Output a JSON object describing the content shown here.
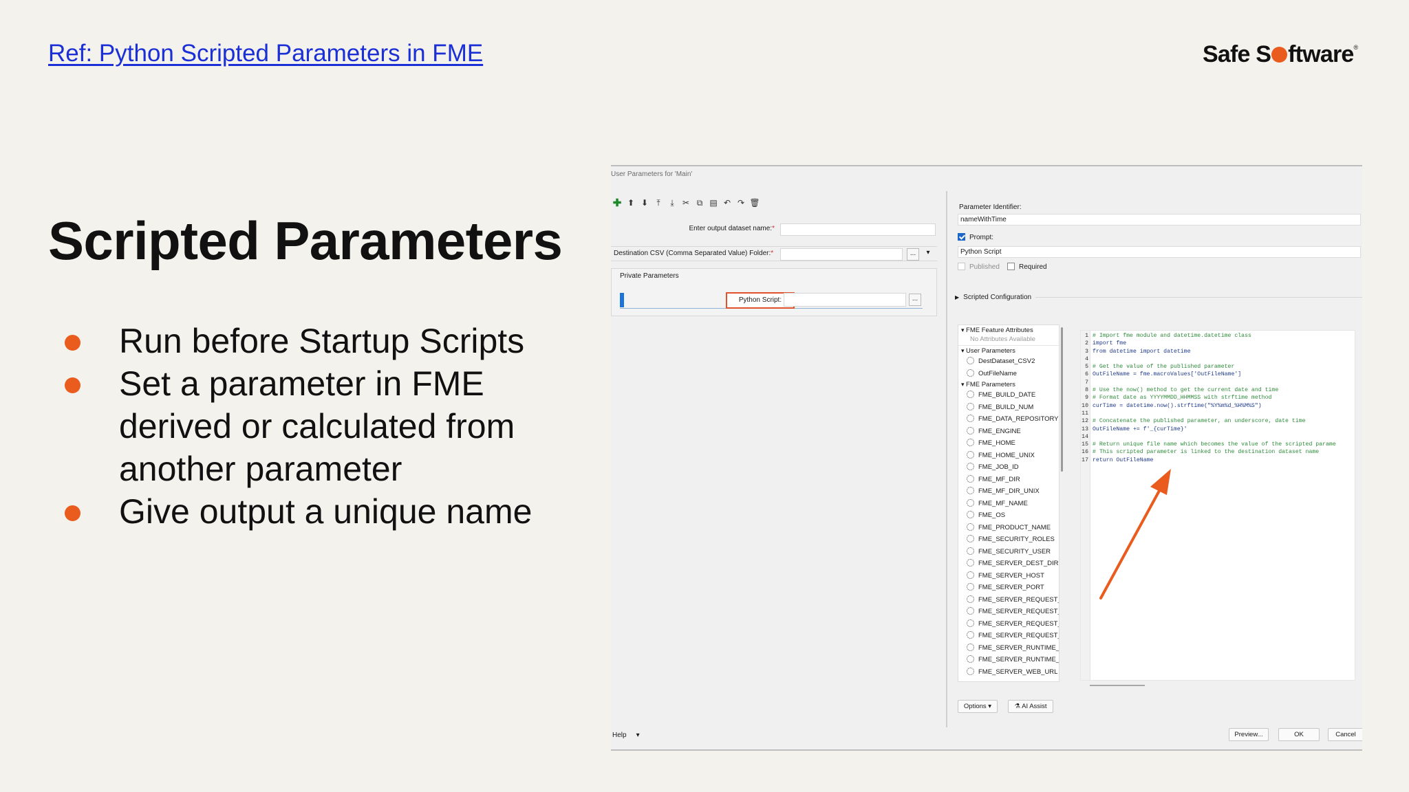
{
  "slide": {
    "ref_link": "Ref: Python Scripted Parameters in FME",
    "logo_text_a": "Safe S",
    "logo_text_b": "ftware",
    "logo_mark": "®",
    "title": "Scripted Parameters",
    "bullets": [
      "Run before Startup Scripts",
      "Set a parameter in FME derived or calculated from another parameter",
      "Give output a unique name"
    ],
    "accent_color": "#ea5b1e",
    "link_color": "#1b2fd6"
  },
  "dialog": {
    "title": "User Parameters for 'Main'",
    "toolbar_icons": [
      "add-icon",
      "move-up-icon",
      "move-down-icon",
      "move-top-icon",
      "move-bottom-icon",
      "cut-icon",
      "copy-icon",
      "paste-icon",
      "undo-icon",
      "redo-icon",
      "delete-icon"
    ],
    "toolbar_glyphs": [
      "✚",
      "⬆",
      "⬇",
      "⤒",
      "⤓",
      "✂",
      "⧉",
      "▤",
      "↶",
      "↷",
      "🗑"
    ],
    "params": {
      "output_name_label": "Enter output dataset name:",
      "dest_folder_label": "Destination CSV (Comma Separated Value) Folder:",
      "required_mark": "*",
      "browse": "...",
      "dropdown": "▾"
    },
    "private": {
      "caption": "Private Parameters",
      "python_script_label": "Python Script:",
      "browse": "..."
    },
    "right": {
      "identifier_label": "Parameter Identifier:",
      "identifier_value": "nameWithTime",
      "prompt_label": "Prompt:",
      "prompt_value": "Python Script",
      "published_label": "Published",
      "required_label": "Required",
      "scripted_config": "Scripted Configuration"
    },
    "tree": {
      "feature_attrs": "FME Feature Attributes",
      "no_attrs": "No Attributes Available",
      "user_params": "User Parameters",
      "user_items": [
        "DestDataset_CSV2",
        "OutFileName"
      ],
      "fme_params": "FME Parameters",
      "fme_items": [
        "FME_BUILD_DATE",
        "FME_BUILD_NUM",
        "FME_DATA_REPOSITORY",
        "FME_ENGINE",
        "FME_HOME",
        "FME_HOME_UNIX",
        "FME_JOB_ID",
        "FME_MF_DIR",
        "FME_MF_DIR_UNIX",
        "FME_MF_NAME",
        "FME_OS",
        "FME_PRODUCT_NAME",
        "FME_SECURITY_ROLES",
        "FME_SECURITY_USER",
        "FME_SERVER_DEST_DIR",
        "FME_SERVER_HOST",
        "FME_SERVER_PORT",
        "FME_SERVER_REQUEST_I",
        "FME_SERVER_REQUEST_N",
        "FME_SERVER_REQUEST_F",
        "FME_SERVER_REQUEST_U",
        "FME_SERVER_RUNTIME_I",
        "FME_SERVER_RUNTIME_I",
        "FME_SERVER_WEB_URL"
      ]
    },
    "code_lines": [
      {
        "n": "1",
        "t": "# Import fme module and datetime.datetime class",
        "c": true
      },
      {
        "n": "2",
        "t": "import fme",
        "c": false
      },
      {
        "n": "3",
        "t": "from datetime import datetime",
        "c": false
      },
      {
        "n": "4",
        "t": "",
        "c": false
      },
      {
        "n": "5",
        "t": "# Get the value of the published parameter",
        "c": true
      },
      {
        "n": "6",
        "t": "OutFileName = fme.macroValues['OutFileName']",
        "c": false
      },
      {
        "n": "7",
        "t": "",
        "c": false
      },
      {
        "n": "8",
        "t": "# Use the now() method to get the current date and time",
        "c": true
      },
      {
        "n": "9",
        "t": "# Format date as YYYYMMDD_HHMMSS with strftime method",
        "c": true
      },
      {
        "n": "10",
        "t": "curTime = datetime.now().strftime(\"%Y%m%d_%H%M%S\")",
        "c": false
      },
      {
        "n": "11",
        "t": "",
        "c": false
      },
      {
        "n": "12",
        "t": "# Concatenate the published parameter, an underscore, date time",
        "c": true
      },
      {
        "n": "13",
        "t": "OutFileName += f'_{curTime}'",
        "c": false
      },
      {
        "n": "14",
        "t": "",
        "c": false
      },
      {
        "n": "15",
        "t": "# Return unique file name which becomes the value of the scripted parame",
        "c": true
      },
      {
        "n": "16",
        "t": "# This scripted parameter is linked to the destination dataset name",
        "c": true
      },
      {
        "n": "17",
        "t": "return OutFileName",
        "c": false
      }
    ],
    "buttons": {
      "options": "Options",
      "ai_assist": "AI Assist",
      "help": "Help",
      "preview": "Preview...",
      "ok": "OK",
      "cancel": "Cancel"
    }
  }
}
